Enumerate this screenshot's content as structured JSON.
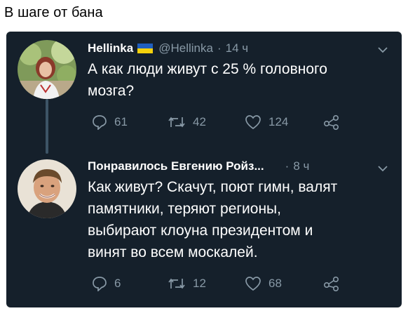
{
  "caption": "В шаге от бана",
  "tweets": [
    {
      "name": "Hellinka",
      "handle": "@Hellinka",
      "separator": "·",
      "time": "14 ч",
      "text": "А как люди живут с 25 % головного\nмозга?",
      "replies": "61",
      "retweets": "42",
      "likes": "124",
      "icons": [
        "reply-icon",
        "retweet-icon",
        "like-icon",
        "share-icon",
        "chevron-down-icon",
        "ukraine-flag-icon"
      ]
    },
    {
      "name": "Понравилось Евгению Ройз...",
      "separator": "·",
      "time": "8 ч",
      "text": "Как живут? Скачут, поют гимн,  валят\nпамятники, теряют регионы,\nвыбирают клоуна президентом и\nвинят во всем москалей.",
      "replies": "6",
      "retweets": "12",
      "likes": "68",
      "icons": [
        "reply-icon",
        "retweet-icon",
        "like-icon",
        "share-icon",
        "chevron-down-icon"
      ]
    }
  ],
  "colors": {
    "card_bg": "#15202b",
    "muted": "#8899a6",
    "thread_line": "#3d5466",
    "flag_blue": "#1f5fbf",
    "flag_yellow": "#f5d10c"
  }
}
